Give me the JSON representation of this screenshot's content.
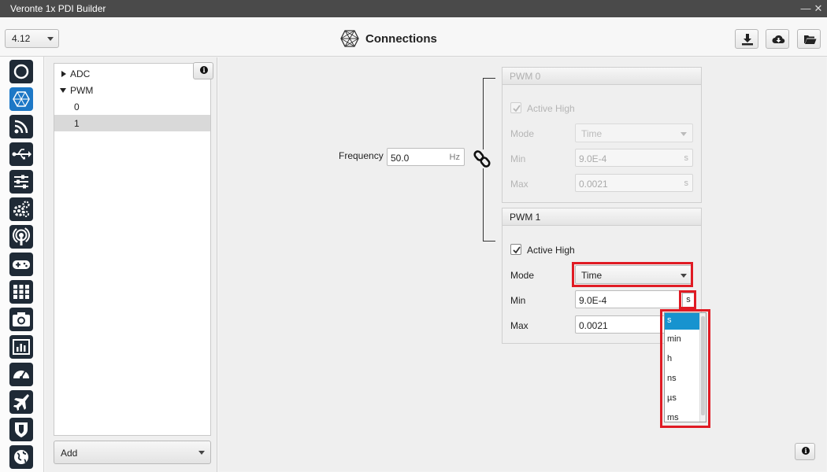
{
  "window": {
    "title": "Veronte 1x PDI Builder",
    "minimize": "—",
    "close": "✕"
  },
  "toolbar": {
    "version": "4.12",
    "page_title": "Connections",
    "buttons": {
      "download": "download-icon",
      "cloud": "cloud-download-icon",
      "folder": "folder-open-icon"
    }
  },
  "sidebar": {
    "items": [
      {
        "name": "power-icon"
      },
      {
        "name": "connections-icon",
        "active": true
      },
      {
        "name": "rss-icon"
      },
      {
        "name": "usb-icon"
      },
      {
        "name": "sliders-icon"
      },
      {
        "name": "gears-icon"
      },
      {
        "name": "broadcast-icon"
      },
      {
        "name": "gamepad-icon"
      },
      {
        "name": "grid-icon"
      },
      {
        "name": "camera-icon"
      },
      {
        "name": "bar-chart-icon"
      },
      {
        "name": "gauge-icon"
      },
      {
        "name": "airplane-icon"
      },
      {
        "name": "shield-icon"
      },
      {
        "name": "globe-icon"
      }
    ]
  },
  "tree": {
    "items": [
      {
        "label": "ADC",
        "expandable": true,
        "expanded": false
      },
      {
        "label": "PWM",
        "expandable": true,
        "expanded": true
      },
      {
        "label": "0"
      },
      {
        "label": "1",
        "selected": true
      }
    ],
    "add_label": "Add"
  },
  "frequency": {
    "label": "Frequency",
    "value": "50.0",
    "unit": "Hz"
  },
  "pwm0": {
    "title": "PWM 0",
    "active_high_label": "Active High",
    "active_high": true,
    "mode_label": "Mode",
    "mode_value": "Time",
    "min_label": "Min",
    "min_value": "9.0E-4",
    "min_unit": "s",
    "max_label": "Max",
    "max_value": "0.0021",
    "max_unit": "s"
  },
  "pwm1": {
    "title": "PWM 1",
    "active_high_label": "Active High",
    "active_high": true,
    "mode_label": "Mode",
    "mode_value": "Time",
    "min_label": "Min",
    "min_value": "9.0E-4",
    "min_unit": "s",
    "max_label": "Max",
    "max_value": "0.0021"
  },
  "unit_dropdown": {
    "options": [
      "s",
      "min",
      "h",
      "ns",
      "µs",
      "ms"
    ],
    "selected": "s"
  },
  "colors": {
    "highlight": "#e01b24",
    "accent": "#1d78c6",
    "selection": "#1793cf"
  }
}
